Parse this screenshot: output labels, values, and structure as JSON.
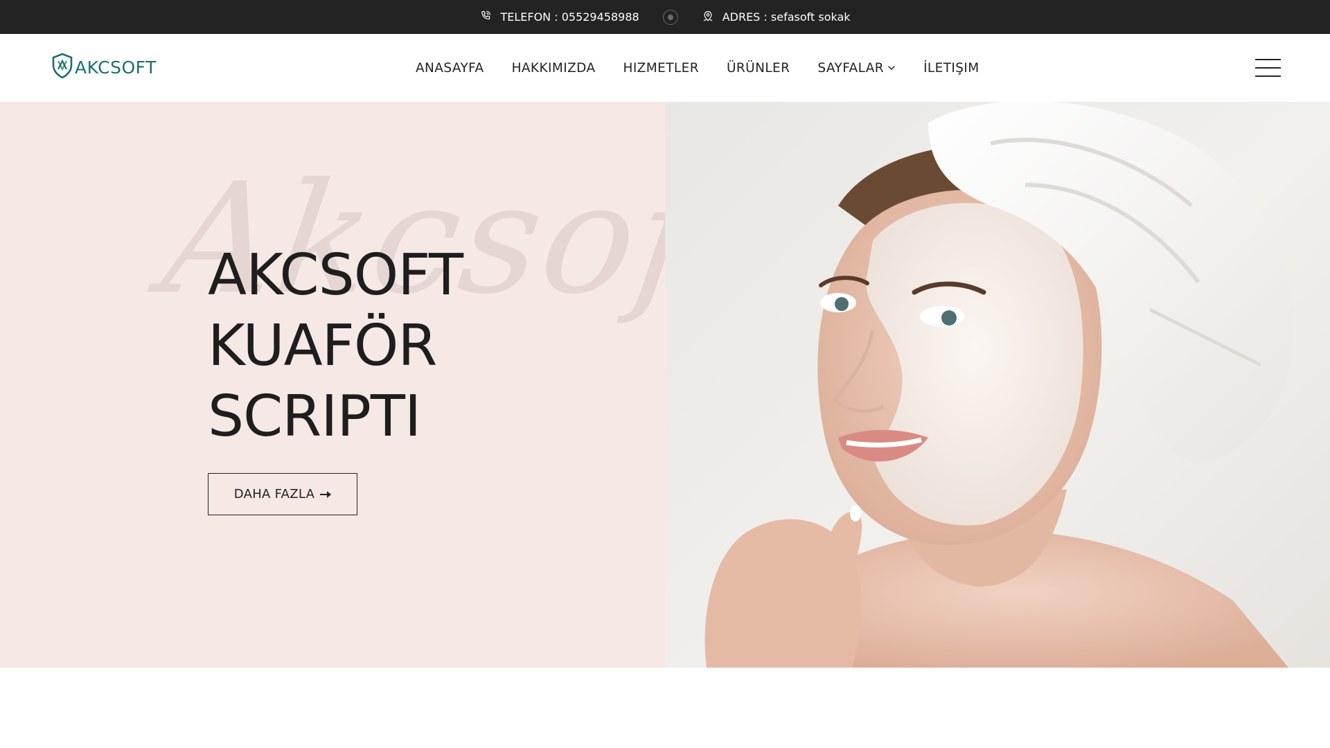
{
  "topbar": {
    "phone_text": "TELEFON : 05529458988",
    "address_text": "ADRES : sefasoft sokak",
    "icons": [
      "phone-icon",
      "separator-dot-icon",
      "location-pin-icon"
    ]
  },
  "header": {
    "logo_text": "AKCSOFT",
    "nav": [
      {
        "label": "ANASAYFA"
      },
      {
        "label": "HAKKIMIZDA"
      },
      {
        "label": "HIZMETLER"
      },
      {
        "label": "ÜRÜNLER"
      },
      {
        "label": "SAYFALAR",
        "has_dropdown": true
      },
      {
        "label": "İLETIŞIM"
      }
    ],
    "menu_icon": "hamburger-menu-icon"
  },
  "hero": {
    "watermark": "Akcsoft",
    "title_lines": [
      "AKCSOFT",
      "KUAFÖR",
      "SCRIPTI"
    ],
    "cta_label": "DAHA FAZLA",
    "cta_icon": "arrow-right-icon",
    "image": "woman-with-towel-and-face-mask-photo"
  },
  "colors": {
    "topbar_bg": "#232323",
    "hero_left_bg": "#f5e8e5",
    "logo_accent": "#1d6d73",
    "text_dark": "#222222"
  }
}
